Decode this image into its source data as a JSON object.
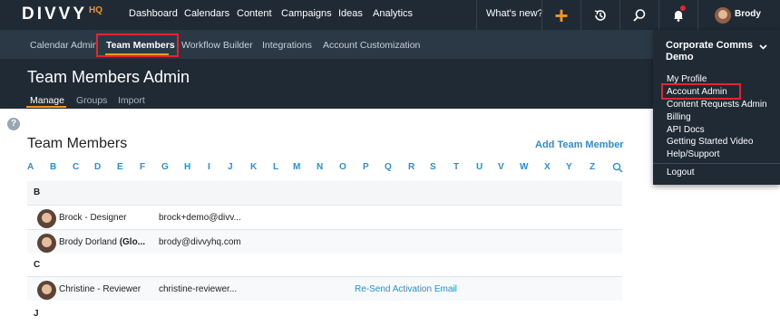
{
  "brand": {
    "name": "DIVVY",
    "suffix": "HQ"
  },
  "topnav": {
    "items": [
      "Dashboard",
      "Calendars",
      "Content",
      "Campaigns",
      "Ideas",
      "Analytics"
    ],
    "whats_new": "What's new?",
    "user": "Brody"
  },
  "subnav": {
    "items": [
      "Calendar Admin",
      "Team Members",
      "Workflow Builder",
      "Integrations",
      "Account Customization"
    ],
    "active": "Team Members"
  },
  "page": {
    "title": "Team Members Admin",
    "tabs": [
      "Manage",
      "Groups",
      "Import"
    ],
    "active_tab": "Manage"
  },
  "team": {
    "title": "Team Members",
    "add_label": "Add Team Member",
    "letters": [
      "A",
      "B",
      "C",
      "D",
      "E",
      "F",
      "G",
      "H",
      "I",
      "J",
      "K",
      "L",
      "M",
      "N",
      "O",
      "P",
      "Q",
      "R",
      "S",
      "T",
      "U",
      "V",
      "W",
      "X",
      "Y",
      "Z"
    ],
    "groups": [
      {
        "label": "B",
        "members": [
          {
            "name": "Brock - Designer",
            "name_bold": "",
            "email": "brock+demo@divv...",
            "action": ""
          },
          {
            "name": "Brody Dorland ",
            "name_bold": "(Glo...",
            "email": "brody@divvyhq.com",
            "action": ""
          }
        ]
      },
      {
        "label": "C",
        "members": [
          {
            "name": "Christine - Reviewer",
            "name_bold": "",
            "email": "christine-reviewer...",
            "action": "Re-Send Activation Email"
          }
        ]
      },
      {
        "label": "J",
        "members": []
      }
    ]
  },
  "account_menu": {
    "org": "Corporate Comms Demo",
    "items": [
      "My Profile",
      "Account Admin",
      "Content Requests Admin",
      "Billing",
      "API Docs",
      "Getting Started Video",
      "Help/Support"
    ],
    "logout": "Logout"
  },
  "colors": {
    "nav_bg": "#1f2a35",
    "subnav_bg": "#2b3946",
    "accent": "#f7941d",
    "link": "#2a8fd8",
    "highlight": "#e1262d"
  }
}
